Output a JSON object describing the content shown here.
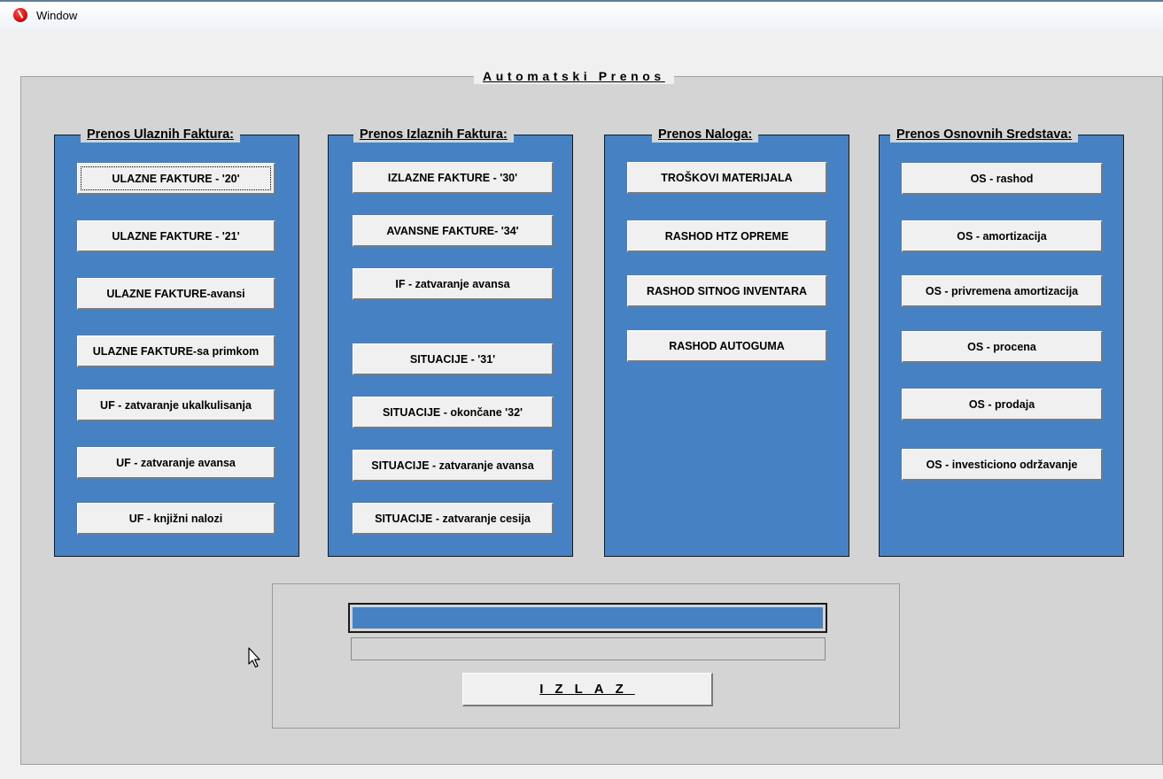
{
  "window": {
    "title": "Window",
    "icon": "app-logo-icon"
  },
  "main_title": "Automatski Prenos",
  "groups": {
    "ulazne": {
      "title": "Prenos Ulaznih Faktura:",
      "buttons": [
        "ULAZNE FAKTURE - '20'",
        "ULAZNE FAKTURE - '21'",
        "ULAZNE FAKTURE-avansi",
        "ULAZNE FAKTURE-sa primkom",
        "UF - zatvaranje ukalkulisanja",
        "UF - zatvaranje avansa",
        "UF - knjižni nalozi"
      ]
    },
    "izlazne": {
      "title": "Prenos Izlaznih Faktura:",
      "buttons": [
        "IZLAZNE FAKTURE - '30'",
        "AVANSNE FAKTURE- '34'",
        "IF - zatvaranje avansa",
        "SITUACIJE - '31'",
        "SITUACIJE - okončane '32'",
        "SITUACIJE - zatvaranje avansa",
        "SITUACIJE - zatvaranje cesija"
      ]
    },
    "nalozi": {
      "title": "Prenos Naloga:",
      "buttons": [
        "TROŠKOVI MATERIJALA",
        "RASHOD HTZ OPREME",
        "RASHOD SITNOG INVENTARA",
        "RASHOD AUTOGUMA"
      ]
    },
    "os": {
      "title": "Prenos Osnovnih Sredstava:",
      "buttons": [
        "OS - rashod",
        "OS - amortizacija",
        "OS - privremena amortizacija",
        "OS - procena",
        "OS - prodaja",
        "OS - investiciono održavanje"
      ]
    }
  },
  "progress": {
    "value_percent": 100,
    "color": "#4682c3"
  },
  "status_text": "",
  "exit_label": "IZLAZ",
  "colors": {
    "panel_blue": "#4682c3",
    "background_gray": "#d4d4d4",
    "button_face": "#f0f0f0"
  }
}
